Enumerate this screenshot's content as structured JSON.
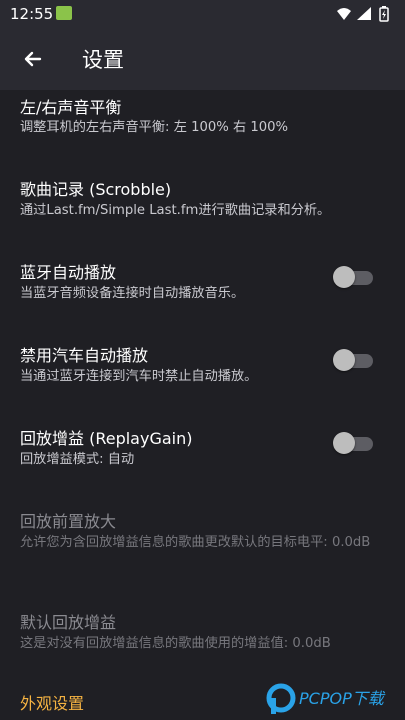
{
  "status": {
    "time": "12:55"
  },
  "appbar": {
    "title": "设置"
  },
  "items": [
    {
      "title": "左/右声音平衡",
      "summary": "调整耳机的左右声音平衡: 左 100% 右 100%"
    },
    {
      "title": "歌曲记录 (Scrobble)",
      "summary": "通过Last.fm/Simple Last.fm进行歌曲记录和分析。"
    },
    {
      "title": "蓝牙自动播放",
      "summary": "当蓝牙音频设备连接时自动播放音乐。",
      "toggle": false
    },
    {
      "title": "禁用汽车自动播放",
      "summary": "当通过蓝牙连接到汽车时禁止自动播放。",
      "toggle": false
    },
    {
      "title": "回放增益 (ReplayGain)",
      "summary": "回放增益模式: 自动",
      "toggle": false
    },
    {
      "title": "回放前置放大",
      "summary": "允许您为含回放增益信息的歌曲更改默认的目标电平: 0.0dB"
    },
    {
      "title": "默认回放增益",
      "summary": "这是对没有回放增益信息的歌曲使用的增益值: 0.0dB"
    }
  ],
  "section_next": "外观设置",
  "watermark": "PCPOP下载"
}
